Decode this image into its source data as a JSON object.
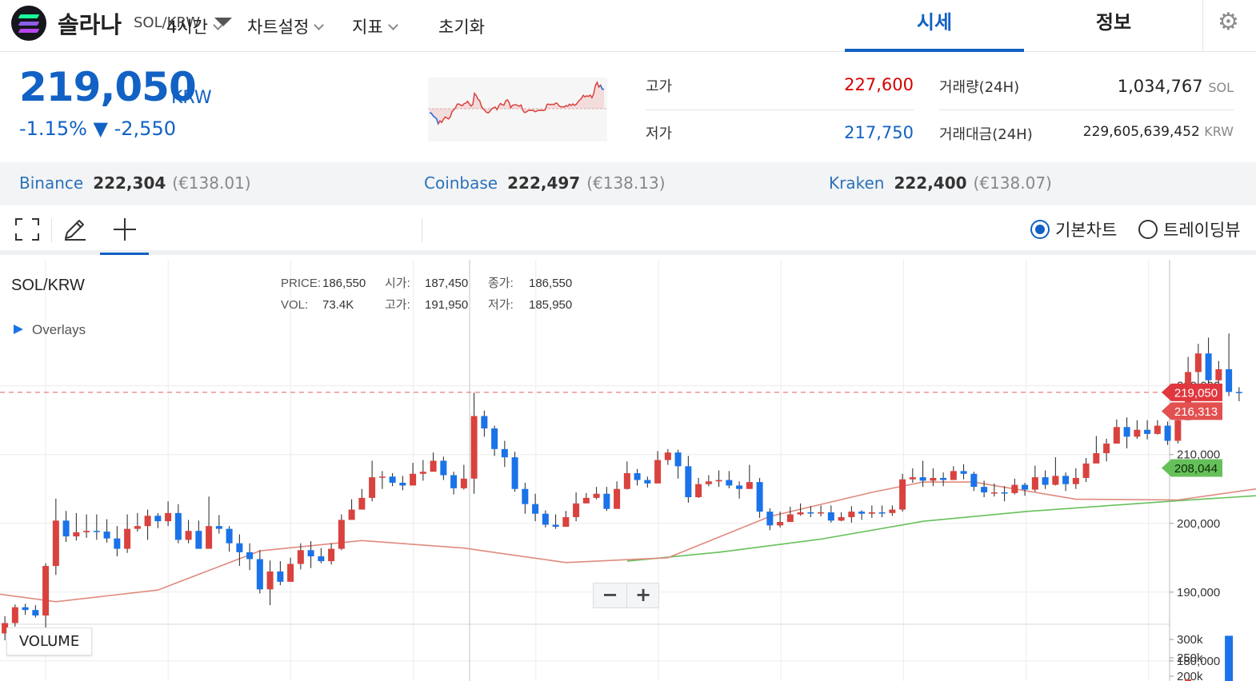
{
  "header": {
    "coin_name": "솔라나",
    "pair": "SOL/KRW",
    "tabs": [
      "시세",
      "정보"
    ],
    "icons": [
      "solana-logo",
      "chevron-down-icon",
      "gear-icon"
    ]
  },
  "ticker": {
    "price": "219,050",
    "price_unit": "KRW",
    "change": "-1.15% ▼ -2,550",
    "high_label": "고가",
    "high": "227,600",
    "low_label": "저가",
    "low": "217,750",
    "volume_label": "거래량(24H)",
    "volume": "1,034,767",
    "volume_unit": "SOL",
    "amount_label": "거래대금(24H)",
    "amount": "229,605,639,452",
    "amount_unit": "KRW"
  },
  "exchanges": [
    {
      "name": "Binance",
      "price": "222,304",
      "eur": "(€138.01)"
    },
    {
      "name": "Coinbase",
      "price": "222,497",
      "eur": "(€138.13)"
    },
    {
      "name": "Kraken",
      "price": "222,400",
      "eur": "(€138.07)"
    }
  ],
  "toolbar": {
    "interval": "4시간",
    "settings": "차트설정",
    "indicators": "지표",
    "reset": "초기화",
    "basic_chart": "기본차트",
    "tradingview": "트레이딩뷰",
    "icons": [
      "fullscreen-icon",
      "pencil-icon",
      "crosshair-icon"
    ]
  },
  "colors": {
    "accent": "#1261c4",
    "up": "#d9423e",
    "down": "#1a73e8",
    "ma_short": "#e08a7e",
    "ma_long": "#66c05a"
  },
  "chart_data": {
    "type": "candlestick",
    "title": "SOL/KRW",
    "overlays_label": "Overlays",
    "legend": {
      "price_label": "PRICE:",
      "price": "186,550",
      "open_label": "시가:",
      "open": "187,450",
      "close_label": "종가:",
      "close": "186,550",
      "vol_label": "VOL:",
      "vol": "73.4K",
      "high_label": "고가:",
      "high": "191,950",
      "low_label": "저가:",
      "low": "185,950"
    },
    "y_ticks": [
      180000,
      190000,
      200000,
      210000,
      220000
    ],
    "y_tick_labels": [
      "180,000",
      "190,000",
      "200,000",
      "210,000",
      "220,000"
    ],
    "ylim": [
      175000,
      230000
    ],
    "current_price": 219050,
    "current_price_label": "219,050",
    "ma_short_value": 216313,
    "ma_short_label": "216,313",
    "ma_long_value": 208044,
    "ma_long_label": "208,044",
    "candles": [
      [
        184000,
        185500,
        186500,
        183000
      ],
      [
        185500,
        187800,
        188200,
        185000
      ],
      [
        187800,
        187400,
        188300,
        186700
      ],
      [
        187400,
        186600,
        188100,
        186300
      ],
      [
        186600,
        193800,
        194200,
        183500
      ],
      [
        193800,
        200400,
        203600,
        192500
      ],
      [
        200400,
        198100,
        201800,
        197300
      ],
      [
        198100,
        198700,
        201500,
        197500
      ],
      [
        198700,
        198900,
        201300,
        197900
      ],
      [
        198900,
        198800,
        201300,
        197600
      ],
      [
        198800,
        197800,
        200600,
        197200
      ],
      [
        197800,
        196300,
        199600,
        195200
      ],
      [
        196300,
        199200,
        201300,
        195700
      ],
      [
        199200,
        199600,
        201500,
        198800
      ],
      [
        199600,
        201100,
        202000,
        197600
      ],
      [
        201100,
        200300,
        201500,
        199300
      ],
      [
        200300,
        201500,
        203200,
        199600
      ],
      [
        201500,
        197600,
        202800,
        197100
      ],
      [
        197600,
        198900,
        200500,
        197100
      ],
      [
        198900,
        196300,
        200400,
        196700
      ],
      [
        196300,
        199600,
        203900,
        196900
      ],
      [
        199600,
        199200,
        201200,
        198500
      ],
      [
        199200,
        197100,
        199600,
        195900
      ],
      [
        197100,
        195800,
        198400,
        193800
      ],
      [
        195800,
        194800,
        197100,
        193200
      ],
      [
        194800,
        190400,
        196100,
        189800
      ],
      [
        190400,
        193000,
        194600,
        188100
      ],
      [
        193000,
        191500,
        194500,
        191000
      ],
      [
        191500,
        194100,
        195000,
        192300
      ],
      [
        194100,
        196100,
        197100,
        193300
      ],
      [
        196100,
        195200,
        197400,
        193500
      ],
      [
        195200,
        194500,
        196400,
        194200
      ],
      [
        194500,
        196300,
        197100,
        194000
      ],
      [
        196300,
        200500,
        201300,
        196100
      ],
      [
        200500,
        202000,
        203500,
        201300
      ],
      [
        202000,
        203700,
        205000,
        202300
      ],
      [
        203700,
        206700,
        209100,
        203200
      ],
      [
        206700,
        206800,
        207600,
        205000
      ],
      [
        206800,
        205900,
        207300,
        205400
      ],
      [
        205900,
        205500,
        206900,
        204800
      ],
      [
        205500,
        207200,
        208800,
        207000
      ],
      [
        207200,
        207500,
        209200,
        206200
      ],
      [
        207500,
        209100,
        210300,
        207900
      ],
      [
        209100,
        207000,
        209700,
        206300
      ],
      [
        207000,
        205100,
        207500,
        204200
      ],
      [
        205100,
        206500,
        208500,
        204900
      ],
      [
        206500,
        215600,
        219000,
        204300
      ],
      [
        215600,
        213800,
        216400,
        212600
      ],
      [
        213800,
        210800,
        214200,
        209800
      ],
      [
        210800,
        209600,
        212000,
        208200
      ],
      [
        209600,
        205000,
        210400,
        204600
      ],
      [
        205000,
        202800,
        205900,
        201400
      ],
      [
        202800,
        201400,
        204300,
        200300
      ],
      [
        201400,
        199800,
        201900,
        199400
      ],
      [
        199800,
        199500,
        201300,
        199200
      ],
      [
        199500,
        200900,
        201800,
        200000
      ],
      [
        200900,
        202900,
        204500,
        200300
      ],
      [
        202900,
        203700,
        204400,
        203000
      ],
      [
        203700,
        204300,
        205300,
        203500
      ],
      [
        204300,
        202100,
        205300,
        201800
      ],
      [
        202100,
        205000,
        206100,
        202200
      ],
      [
        205000,
        207300,
        209000,
        204900
      ],
      [
        207300,
        206300,
        207900,
        205500
      ],
      [
        206300,
        205800,
        206800,
        205200
      ],
      [
        205800,
        209200,
        210500,
        206500
      ],
      [
        209200,
        210300,
        210800,
        208500
      ],
      [
        210300,
        208300,
        210700,
        206500
      ],
      [
        208300,
        203800,
        209800,
        203000
      ],
      [
        203800,
        205700,
        206600,
        203700
      ],
      [
        205700,
        206100,
        207000,
        205400
      ],
      [
        206100,
        206300,
        207700,
        205300
      ],
      [
        206300,
        205500,
        207600,
        205100
      ],
      [
        205500,
        205000,
        206100,
        203600
      ],
      [
        205000,
        206000,
        208500,
        205000
      ],
      [
        206000,
        201700,
        206600,
        200800
      ],
      [
        201700,
        199700,
        202200,
        199000
      ],
      [
        199700,
        200200,
        201700,
        199400
      ],
      [
        200200,
        201300,
        202400,
        200400
      ],
      [
        201300,
        201600,
        202900,
        201100
      ],
      [
        201600,
        201500,
        202500,
        200900
      ],
      [
        201500,
        201600,
        202600,
        201000
      ],
      [
        201600,
        200400,
        202600,
        200100
      ],
      [
        200400,
        200900,
        201600,
        200300
      ],
      [
        200900,
        201700,
        202500,
        200100
      ],
      [
        201700,
        201400,
        201900,
        200500
      ],
      [
        201400,
        201600,
        202600,
        200800
      ],
      [
        201600,
        201500,
        202600,
        200900
      ],
      [
        201500,
        202000,
        202600,
        201100
      ],
      [
        202000,
        206400,
        207200,
        201700
      ],
      [
        206400,
        206700,
        208000,
        205900
      ],
      [
        206700,
        206200,
        209100,
        205300
      ],
      [
        206200,
        206600,
        208000,
        205400
      ],
      [
        206600,
        206300,
        207400,
        205400
      ],
      [
        206300,
        207600,
        208300,
        206600
      ],
      [
        207600,
        207200,
        208600,
        206400
      ],
      [
        207200,
        205300,
        207500,
        204700
      ],
      [
        205300,
        204500,
        206200,
        203800
      ],
      [
        204500,
        204500,
        205800,
        203900
      ],
      [
        204500,
        204400,
        205400,
        203200
      ],
      [
        204400,
        205600,
        206500,
        204200
      ],
      [
        205600,
        204900,
        205900,
        204000
      ],
      [
        204900,
        206700,
        208400,
        204600
      ],
      [
        206700,
        205600,
        207700,
        205000
      ],
      [
        205600,
        206900,
        209600,
        205500
      ],
      [
        206900,
        205700,
        207400,
        204700
      ],
      [
        205700,
        206600,
        208000,
        205000
      ],
      [
        206600,
        208700,
        209500,
        206000
      ],
      [
        208700,
        210200,
        212700,
        208800
      ],
      [
        210200,
        211600,
        212300,
        209000
      ],
      [
        211600,
        214000,
        215100,
        211600
      ],
      [
        214000,
        212600,
        215400,
        210900
      ],
      [
        212600,
        213600,
        215000,
        212300
      ],
      [
        213600,
        213000,
        215000,
        212200
      ],
      [
        213000,
        214200,
        215000,
        212900
      ],
      [
        214200,
        212000,
        214800,
        211400
      ],
      [
        212000,
        215000,
        216100,
        211600
      ],
      [
        215000,
        222000,
        224200,
        215000
      ],
      [
        222000,
        224700,
        226100,
        219400
      ],
      [
        224700,
        220800,
        227000,
        219200
      ],
      [
        220800,
        222400,
        223600,
        220500
      ],
      [
        222400,
        219100,
        227600,
        218500
      ],
      [
        219100,
        219050,
        219800,
        217750
      ]
    ],
    "ma_short": [
      [
        -1,
        189800
      ],
      [
        5,
        188600
      ],
      [
        15,
        190300
      ],
      [
        25,
        196000
      ],
      [
        35,
        197500
      ],
      [
        45,
        196400
      ],
      [
        55,
        194300
      ],
      [
        65,
        195000
      ],
      [
        75,
        201000
      ],
      [
        85,
        204500
      ],
      [
        90,
        206000
      ],
      [
        95,
        206000
      ],
      [
        105,
        203500
      ],
      [
        115,
        203400
      ],
      [
        125,
        205500
      ],
      [
        135,
        205500
      ],
      [
        145,
        204000
      ],
      [
        155,
        202500
      ],
      [
        165,
        203000
      ],
      [
        175,
        205200
      ],
      [
        185,
        206300
      ],
      [
        195,
        207900
      ],
      [
        200,
        209200
      ],
      [
        205,
        211100
      ],
      [
        211,
        213200
      ],
      [
        216,
        215000
      ],
      [
        220,
        216313
      ]
    ],
    "ma_long": [
      [
        61,
        194500
      ],
      [
        70,
        195800
      ],
      [
        80,
        197700
      ],
      [
        90,
        200300
      ],
      [
        100,
        201700
      ],
      [
        115,
        203300
      ],
      [
        130,
        204700
      ],
      [
        145,
        205500
      ],
      [
        155,
        205600
      ],
      [
        165,
        205200
      ],
      [
        175,
        205100
      ],
      [
        185,
        205900
      ],
      [
        195,
        206900
      ],
      [
        205,
        207800
      ],
      [
        212,
        208500
      ],
      [
        220,
        208044
      ]
    ],
    "volume_label": "VOLUME",
    "volume_ticks": [
      "300k",
      "250k",
      "200k"
    ],
    "volume_bars": [
      12000,
      310000
    ]
  }
}
